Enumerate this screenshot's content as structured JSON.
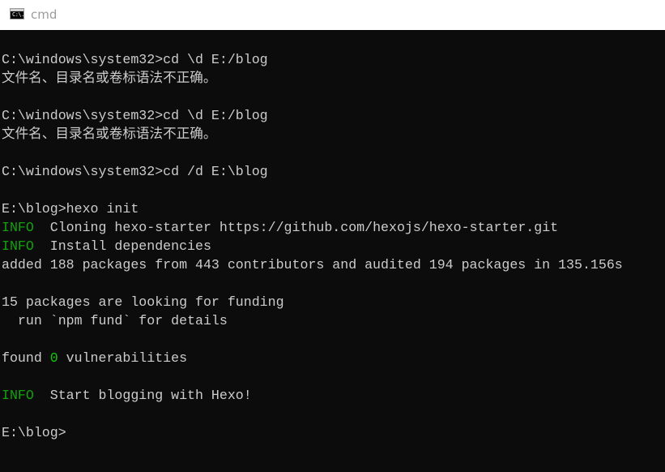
{
  "window": {
    "title": "cmd",
    "icon": "cmd-console-icon",
    "icon_glyph": "C:\\."
  },
  "colors": {
    "console_bg": "#0c0c0c",
    "console_text": "#cccccc",
    "info_tag": "#13a10e",
    "highlight_number": "#16c60c",
    "title_text": "#9b9b9b"
  },
  "console": {
    "lines": [
      {
        "text": "C:\\windows\\system32>cd \\d E:/blog"
      },
      {
        "text": "文件名、目录名或卷标语法不正确。"
      },
      {
        "text": ""
      },
      {
        "text": "C:\\windows\\system32>cd \\d E:/blog"
      },
      {
        "text": "文件名、目录名或卷标语法不正确。"
      },
      {
        "text": ""
      },
      {
        "text": "C:\\windows\\system32>cd /d E:\\blog"
      },
      {
        "text": ""
      },
      {
        "text": "E:\\blog>hexo init"
      },
      {
        "tag": "INFO",
        "text": "  Cloning hexo-starter https://github.com/hexojs/hexo-starter.git"
      },
      {
        "tag": "INFO",
        "text": "  Install dependencies"
      },
      {
        "text": "added 188 packages from 443 contributors and audited 194 packages in 135.156s"
      },
      {
        "text": ""
      },
      {
        "text": "15 packages are looking for funding"
      },
      {
        "text": "  run `npm fund` for details"
      },
      {
        "text": ""
      },
      {
        "pre": "found ",
        "num": "0",
        "post": " vulnerabilities"
      },
      {
        "text": ""
      },
      {
        "tag": "INFO",
        "text": "  Start blogging with Hexo!"
      },
      {
        "text": ""
      },
      {
        "text": "E:\\blog>"
      }
    ]
  }
}
